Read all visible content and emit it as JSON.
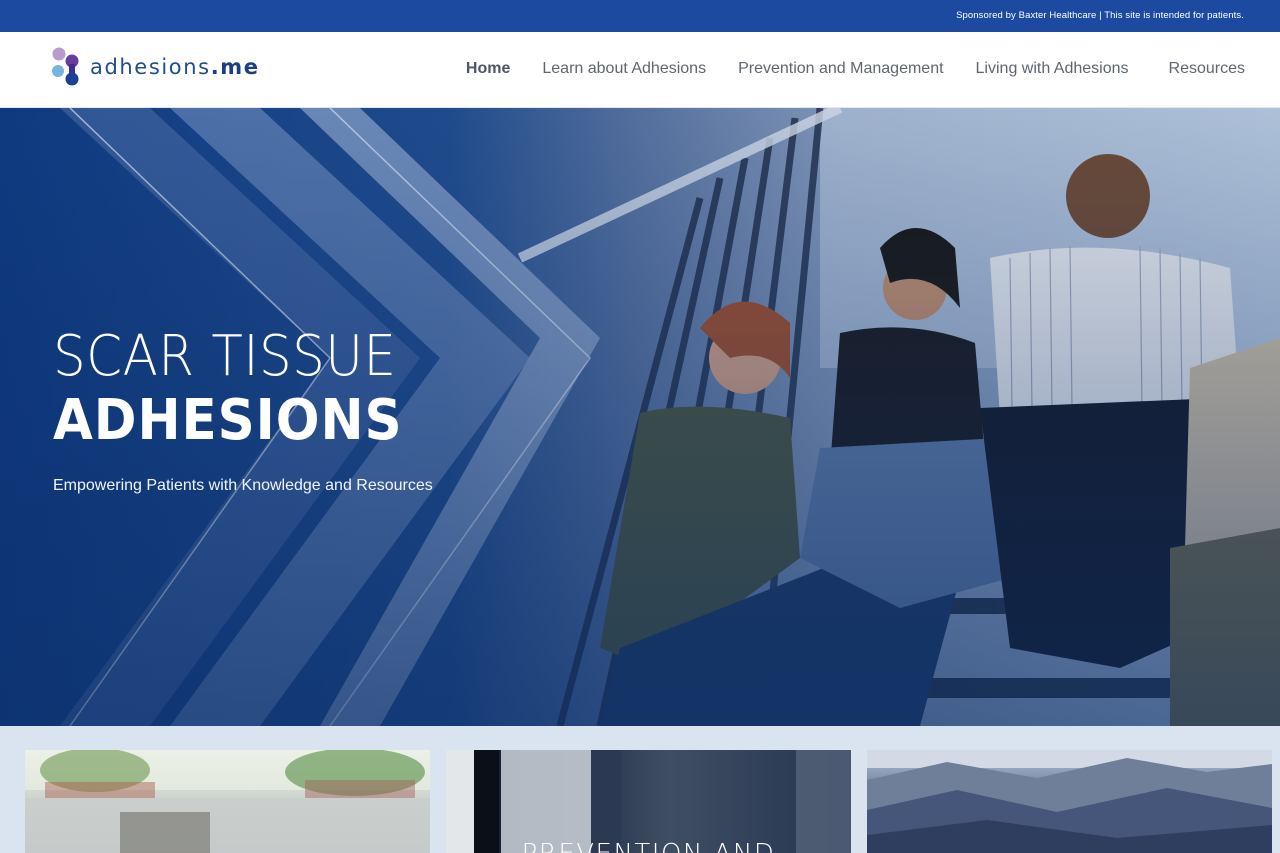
{
  "topbar": {
    "sponsor_text": "Sponsored by Baxter Healthcare | This site is intended for patients."
  },
  "header": {
    "logo": {
      "name": "adhesions",
      "tld": ".me",
      "icon": "adhesions-molecule-logo-icon"
    },
    "nav": [
      {
        "label": "Home",
        "active": true
      },
      {
        "label": "Learn about Adhesions",
        "active": false
      },
      {
        "label": "Prevention and Management",
        "active": false
      },
      {
        "label": "Living with Adhesions",
        "active": false
      },
      {
        "label": "Resources",
        "active": false
      }
    ]
  },
  "hero": {
    "title_line1": "SCAR TISSUE",
    "title_line2": "ADHESIONS",
    "subtitle": "Empowering Patients with Knowledge and Resources",
    "image": "group-of-people-sitting-on-stairs-photo"
  },
  "cards": [
    {
      "title": "",
      "image": "blurred-park-scene-photo"
    },
    {
      "title": "PREVENTION AND",
      "image": "dark-interior-photo"
    },
    {
      "title": "",
      "image": "mountain-landscape-photo"
    }
  ],
  "colors": {
    "topbar": "#1b4aa0",
    "brand_blue": "#1f4e8f",
    "nav_text": "#5b6774",
    "hero_overlay": "#0e3a7e"
  }
}
